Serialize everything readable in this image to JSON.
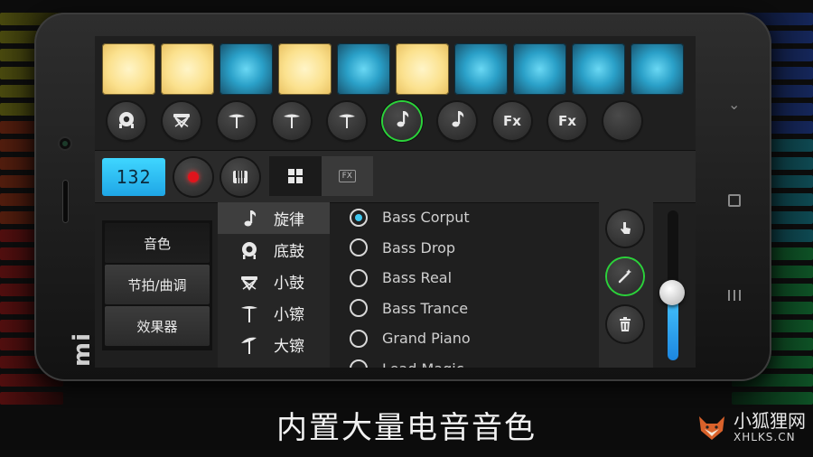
{
  "pads": [
    "yellow",
    "yellow",
    "blue",
    "yellow",
    "blue",
    "yellow",
    "blue",
    "blue",
    "blue",
    "blue"
  ],
  "instrument_buttons": [
    {
      "icon": "drum-icon"
    },
    {
      "icon": "snare-icon"
    },
    {
      "icon": "cymbal-icon"
    },
    {
      "icon": "cymbal-icon"
    },
    {
      "icon": "cymbal-icon"
    },
    {
      "icon": "music-note-icon",
      "active": true
    },
    {
      "icon": "music-note-icon"
    },
    {
      "icon": "fx-icon",
      "label": "Fx"
    },
    {
      "icon": "fx-icon",
      "label": "Fx"
    },
    {
      "icon": "empty-icon"
    }
  ],
  "controls": {
    "bpm": "132",
    "fx_tab_label": "FX"
  },
  "categories": [
    {
      "label": "音色",
      "selected": true
    },
    {
      "label": "节拍/曲调",
      "selected": false
    },
    {
      "label": "效果器",
      "selected": false
    }
  ],
  "instruments": [
    {
      "label": "旋律",
      "icon": "music-note-icon",
      "selected": true
    },
    {
      "label": "底鼓",
      "icon": "bass-drum-icon",
      "selected": false
    },
    {
      "label": "小鼓",
      "icon": "snare-icon",
      "selected": false
    },
    {
      "label": "小镲",
      "icon": "hihat-icon",
      "selected": false
    },
    {
      "label": "大镲",
      "icon": "crash-cymbal-icon",
      "selected": false
    }
  ],
  "sounds": [
    {
      "label": "Bass Corput",
      "selected": true
    },
    {
      "label": "Bass Drop",
      "selected": false
    },
    {
      "label": "Bass Real",
      "selected": false
    },
    {
      "label": "Bass Trance",
      "selected": false
    },
    {
      "label": "Grand Piano",
      "selected": false
    },
    {
      "label": "Lead Magic",
      "selected": false
    }
  ],
  "volume": 0.45,
  "colors": {
    "accent": "#3fc8f0",
    "active_ring": "#2bd23a",
    "record": "#e0141c",
    "pad_yellow": "#fbe18e",
    "pad_blue": "#2aa0c8"
  },
  "caption": "内置大量电音音色",
  "watermark": {
    "name": "小狐狸网",
    "domain": "XHLKS.CN"
  }
}
